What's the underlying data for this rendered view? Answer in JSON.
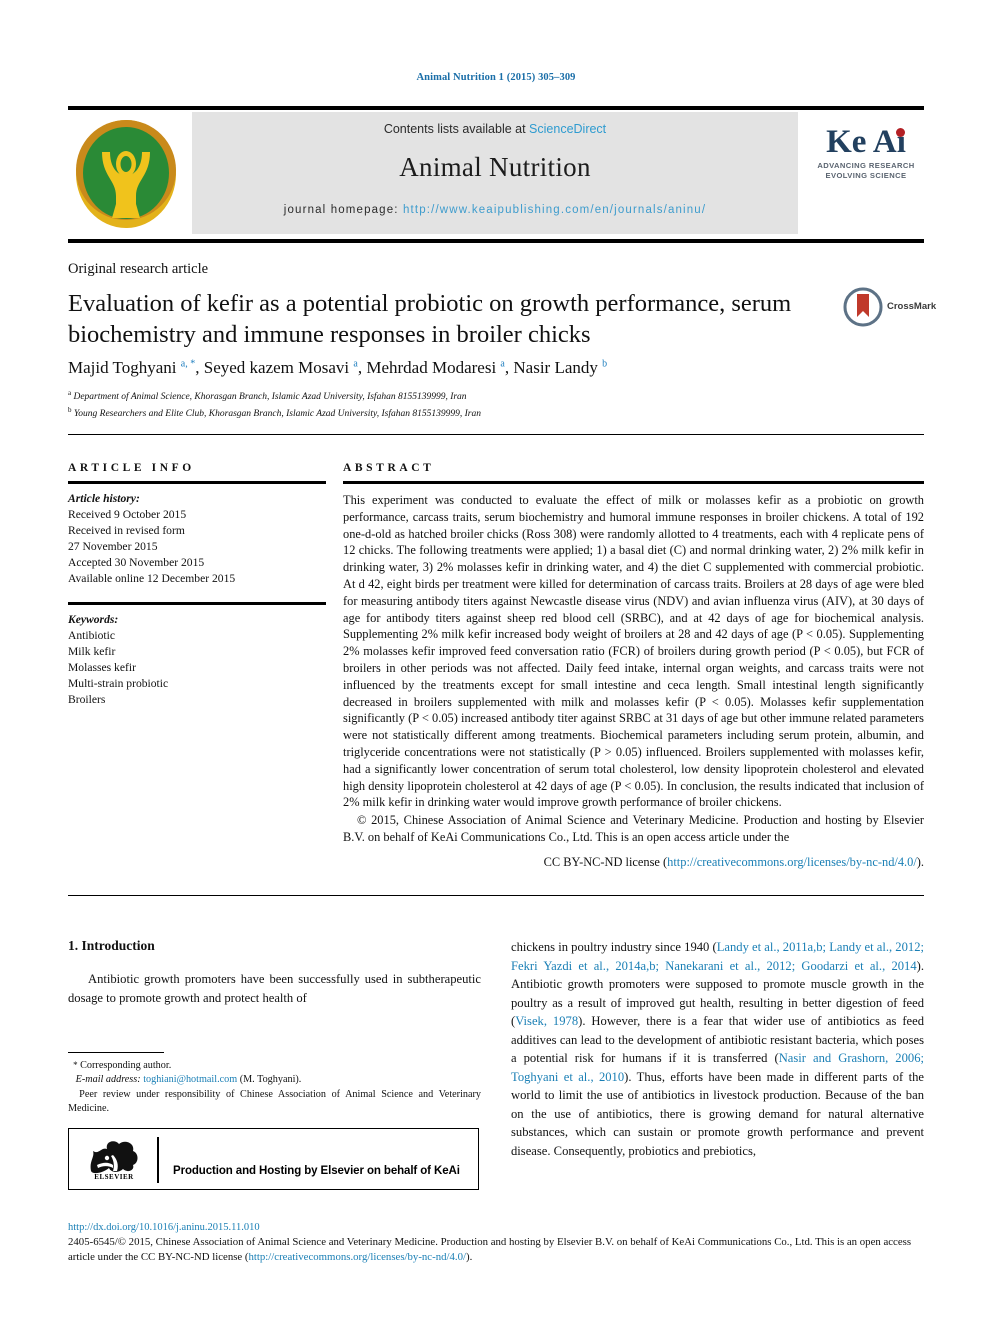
{
  "running_head": "Animal Nutrition 1 (2015) 305–309",
  "masthead": {
    "contents_prefix": "Contents lists available at ",
    "sciencedirect": "ScienceDirect",
    "journal_title": "Animal Nutrition",
    "homepage_prefix": "journal homepage: ",
    "homepage_url": "http://www.keaipublishing.com/en/journals/aninu/",
    "keai_word": "Ke Ai",
    "keai_tagline_1": "ADVANCING RESEARCH",
    "keai_tagline_2": "EVOLVING SCIENCE",
    "logo_alt": "animal-nutrition-journal-logo"
  },
  "article": {
    "type": "Original research article",
    "title": "Evaluation of kefir as a potential probiotic on growth performance, serum biochemistry and immune responses in broiler chicks",
    "crossmark_label": "CrossMark",
    "authors_html": "Majid Toghyani <sup>a, *</sup>, Seyed kazem Mosavi <sup>a</sup>, Mehrdad Modaresi <sup>a</sup>, Nasir Landy <sup>b</sup>",
    "affiliation_a": "Department of Animal Science, Khorasgan Branch, Islamic Azad University, Isfahan 8155139999, Iran",
    "affiliation_b": "Young Researchers and Elite Club, Khorasgan Branch, Islamic Azad University, Isfahan 8155139999, Iran"
  },
  "info": {
    "heading": "ARTICLE INFO",
    "history_label": "Article history:",
    "history": [
      "Received 9 October 2015",
      "Received in revised form",
      "27 November 2015",
      "Accepted 30 November 2015",
      "Available online 12 December 2015"
    ],
    "keywords_label": "Keywords:",
    "keywords": [
      "Antibiotic",
      "Milk kefir",
      "Molasses kefir",
      "Multi-strain probiotic",
      "Broilers"
    ]
  },
  "abstract": {
    "heading": "ABSTRACT",
    "body": "This experiment was conducted to evaluate the effect of milk or molasses kefir as a probiotic on growth performance, carcass traits, serum biochemistry and humoral immune responses in broiler chickens. A total of 192 one-d-old as hatched broiler chicks (Ross 308) were randomly allotted to 4 treatments, each with 4 replicate pens of 12 chicks. The following treatments were applied; 1) a basal diet (C) and normal drinking water, 2) 2% milk kefir in drinking water, 3) 2% molasses kefir in drinking water, and 4) the diet C supplemented with commercial probiotic. At d 42, eight birds per treatment were killed for determination of carcass traits. Broilers at 28 days of age were bled for measuring antibody titers against Newcastle disease virus (NDV) and avian influenza virus (AIV), at 30 days of age for antibody titers against sheep red blood cell (SRBC), and at 42 days of age for biochemical analysis. Supplementing 2% milk kefir increased body weight of broilers at 28 and 42 days of age (P < 0.05). Supplementing 2% molasses kefir improved feed conversation ratio (FCR) of broilers during growth period (P < 0.05), but FCR of broilers in other periods was not affected. Daily feed intake, internal organ weights, and carcass traits were not influenced by the treatments except for small intestine and ceca length. Small intestinal length significantly decreased in broilers supplemented with milk and molasses kefir (P < 0.05). Molasses kefir supplementation significantly (P < 0.05) increased antibody titer against SRBC at 31 days of age but other immune related parameters were not statistically different among treatments. Biochemical parameters including serum protein, albumin, and triglyceride concentrations were not statistically (P > 0.05) influenced. Broilers supplemented with molasses kefir, had a significantly lower concentration of serum total cholesterol, low density lipoprotein cholesterol and elevated high density lipoprotein cholesterol at 42 days of age (P < 0.05). In conclusion, the results indicated that inclusion of 2% milk kefir in drinking water would improve growth performance of broiler chickens.",
    "copyright": "© 2015, Chinese Association of Animal Science and Veterinary Medicine. Production and hosting by Elsevier B.V. on behalf of KeAi Communications Co., Ltd. This is an open access article under the",
    "license_prefix": "CC BY-NC-ND license (",
    "license_url": "http://creativecommons.org/licenses/by-nc-nd/4.0/",
    "license_suffix": ")."
  },
  "introduction": {
    "heading": "1. Introduction",
    "left_para": "Antibiotic growth promoters have been successfully used in subtherapeutic dosage to promote growth and protect health of",
    "right_para_1_text_a": "chickens in poultry industry since 1940 (",
    "right_para_1_cite_a": "Landy et al., 2011a,b; Landy et al., 2012; Fekri Yazdi et al., 2014a,b; Nanekarani et al., 2012; Goodarzi et al., 2014",
    "right_para_1_text_b": "). Antibiotic growth promoters were supposed to promote muscle growth in the poultry as a result of improved gut health, resulting in better digestion of feed (",
    "right_para_1_cite_b": "Visek, 1978",
    "right_para_1_text_c": "). However, there is a fear that wider use of antibiotics as feed additives can lead to the development of antibiotic resistant bacteria, which poses a potential risk for humans if it is transferred (",
    "right_para_1_cite_c": "Nasir and Grashorn, 2006; Toghyani et al., 2010",
    "right_para_1_text_d": "). Thus, efforts have been made in different parts of the world to limit the use of antibiotics in livestock production. Because of the ban on the use of antibiotics, there is growing demand for natural alternative substances, which can sustain or promote growth performance and prevent disease. Consequently, probiotics and prebiotics,"
  },
  "footnote": {
    "star": "*",
    "corresponding": "Corresponding author.",
    "email_label": "E-mail address:",
    "email": "toghiani@hotmail.com",
    "email_suffix": "(M. Toghyani).",
    "peer_review": "Peer review under responsibility of Chinese Association of Animal Science and Veterinary Medicine.",
    "production_box_text": "Production and Hosting by Elsevier on behalf of KeAi",
    "elsevier_word": "ELSEVIER"
  },
  "footer": {
    "doi": "http://dx.doi.org/10.1016/j.aninu.2015.11.010",
    "issn_text": "2405-6545/© 2015, Chinese Association of Animal Science and Veterinary Medicine. Production and hosting by Elsevier B.V. on behalf of KeAi Communications Co., Ltd. This is an open access article under the CC BY-NC-ND license (",
    "license_url": "http://creativecommons.org/licenses/by-nc-nd/4.0/",
    "license_suffix": ")."
  },
  "colors": {
    "link_blue": "#1a7fb5",
    "sciencedirect_blue": "#2e9bd0",
    "keai_navy": "#22405f",
    "keai_red": "#b32025",
    "logo_green": "#2a8a36",
    "logo_gold": "#e8a91c",
    "band_gray": "#e3e3e3"
  }
}
